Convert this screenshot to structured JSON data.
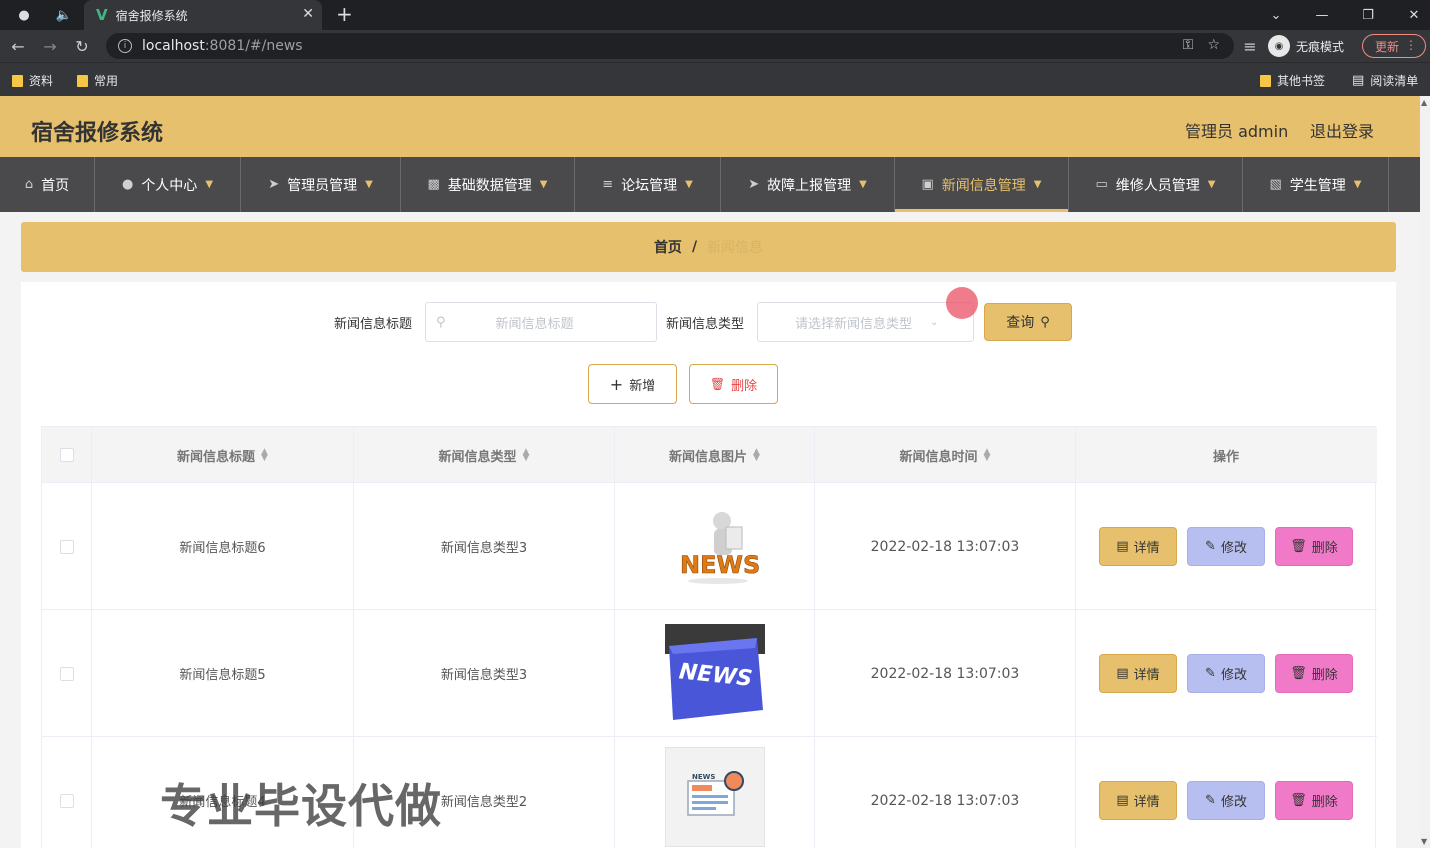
{
  "browser": {
    "tab_title": "宿舍报修系统",
    "url_host": "localhost",
    "url_rest": ":8081/#/news",
    "incognito_label": "无痕模式",
    "update_label": "更新",
    "bookmarks": [
      "资料",
      "常用"
    ],
    "bookmarks_right": [
      "其他书签",
      "阅读清单"
    ]
  },
  "header": {
    "title": "宿舍报修系统",
    "admin": "管理员 admin",
    "logout": "退出登录"
  },
  "nav": [
    {
      "label": "首页",
      "icon": "home-icon"
    },
    {
      "label": "个人中心",
      "icon": "user-icon"
    },
    {
      "label": "管理员管理",
      "icon": "paper-plane-icon"
    },
    {
      "label": "基础数据管理",
      "icon": "stamp-icon"
    },
    {
      "label": "论坛管理",
      "icon": "sliders-icon"
    },
    {
      "label": "故障上报管理",
      "icon": "send-icon"
    },
    {
      "label": "新闻信息管理",
      "icon": "wallet-icon",
      "active": true
    },
    {
      "label": "维修人员管理",
      "icon": "monitor-icon"
    },
    {
      "label": "学生管理",
      "icon": "chat-icon"
    }
  ],
  "breadcrumb": {
    "home": "首页",
    "separator": "/",
    "current": "新闻信息"
  },
  "filters": {
    "title_label": "新闻信息标题",
    "title_placeholder": "新闻信息标题",
    "type_label": "新闻信息类型",
    "type_placeholder": "请选择新闻信息类型",
    "search_label": "查询"
  },
  "actions": {
    "add_label": "新增",
    "delete_label": "删除"
  },
  "table": {
    "columns": [
      "新闻信息标题",
      "新闻信息类型",
      "新闻信息图片",
      "新闻信息时间",
      "操作"
    ],
    "rows": [
      {
        "title": "新闻信息标题6",
        "type": "新闻信息类型3",
        "image": "news-3d-figure-image",
        "time": "2022-02-18 13:07:03"
      },
      {
        "title": "新闻信息标题5",
        "type": "新闻信息类型3",
        "image": "news-keyboard-key-image",
        "time": "2022-02-18 13:07:03"
      },
      {
        "title": "新闻信息标题4",
        "type": "新闻信息类型2",
        "image": "newspaper-illustration-image",
        "time": "2022-02-18 13:07:03"
      }
    ],
    "op_labels": {
      "detail": "详情",
      "edit": "修改",
      "delete": "删除"
    }
  },
  "watermark": "专业毕设代做",
  "colors": {
    "accent": "#e6c06c",
    "nav_bg": "#4a4a4c",
    "edit_btn": "#b7bff0",
    "delete_btn": "#f07ac8",
    "danger_text": "#e64444"
  }
}
